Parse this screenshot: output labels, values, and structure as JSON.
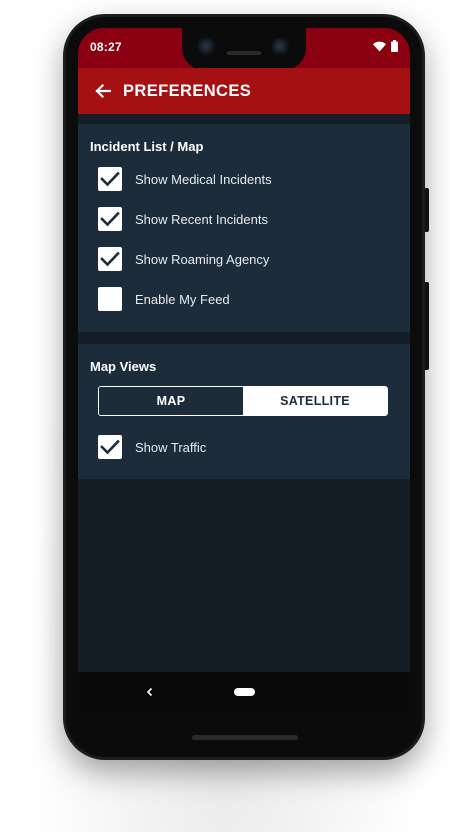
{
  "status_bar": {
    "time": "08:27",
    "icons": [
      "wifi-icon",
      "battery-icon"
    ]
  },
  "app_bar": {
    "back_icon": "arrow-left-icon",
    "title": "PREFERENCES"
  },
  "incident_section": {
    "title": "Incident List / Map",
    "options": [
      {
        "label": "Show Medical Incidents",
        "checked": true
      },
      {
        "label": "Show Recent Incidents",
        "checked": true
      },
      {
        "label": "Show Roaming Agency",
        "checked": true
      },
      {
        "label": "Enable My Feed",
        "checked": false
      }
    ]
  },
  "map_views_section": {
    "title": "Map Views",
    "toggle": {
      "options": [
        "MAP",
        "SATELLITE"
      ],
      "selected": "SATELLITE"
    },
    "options": [
      {
        "label": "Show Traffic",
        "checked": true
      }
    ]
  },
  "nav_bar": {
    "icons": [
      "nav-back-icon",
      "nav-home-pill"
    ]
  },
  "colors": {
    "status_bar": "#8b0010",
    "app_bar": "#a51012",
    "section_background": "#1d2c3b",
    "screen_background": "#151d27",
    "checkbox": "#ffffff",
    "checkmark": "#1d2c3b"
  }
}
